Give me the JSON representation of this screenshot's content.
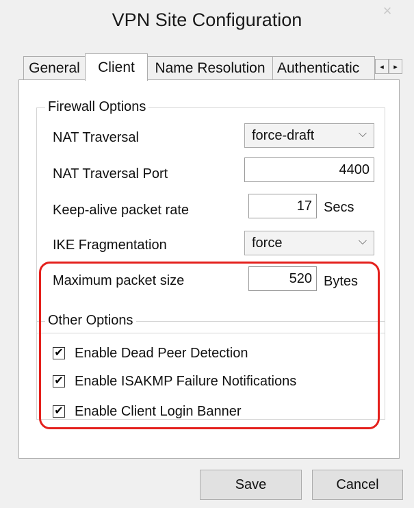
{
  "window": {
    "title": "VPN Site Configuration",
    "close_glyph": "×"
  },
  "tabs": [
    {
      "label": "General",
      "active": false
    },
    {
      "label": "Client",
      "active": true
    },
    {
      "label": "Name Resolution",
      "active": false
    },
    {
      "label": "Authenticatic",
      "active": false
    }
  ],
  "tab_scroll": {
    "left": "◂",
    "right": "▸"
  },
  "firewall": {
    "legend": "Firewall Options",
    "nat_traversal": {
      "label": "NAT Traversal",
      "value": "force-draft"
    },
    "nat_port": {
      "label": "NAT Traversal Port",
      "value": "4400"
    },
    "keepalive": {
      "label": "Keep-alive packet rate",
      "value": "17",
      "unit": "Secs"
    },
    "ike_frag": {
      "label": "IKE Fragmentation",
      "value": "force"
    },
    "max_packet": {
      "label": "Maximum packet size",
      "value": "520",
      "unit": "Bytes"
    }
  },
  "other": {
    "legend": "Other Options",
    "options": [
      {
        "label": "Enable Dead Peer Detection",
        "checked": true
      },
      {
        "label": "Enable ISAKMP Failure Notifications",
        "checked": true
      },
      {
        "label": "Enable Client Login Banner",
        "checked": true
      }
    ]
  },
  "buttons": {
    "save": "Save",
    "cancel": "Cancel"
  },
  "icons": {
    "chevron": "⌵",
    "check": "✔"
  },
  "colors": {
    "highlight": "#e4201c"
  }
}
